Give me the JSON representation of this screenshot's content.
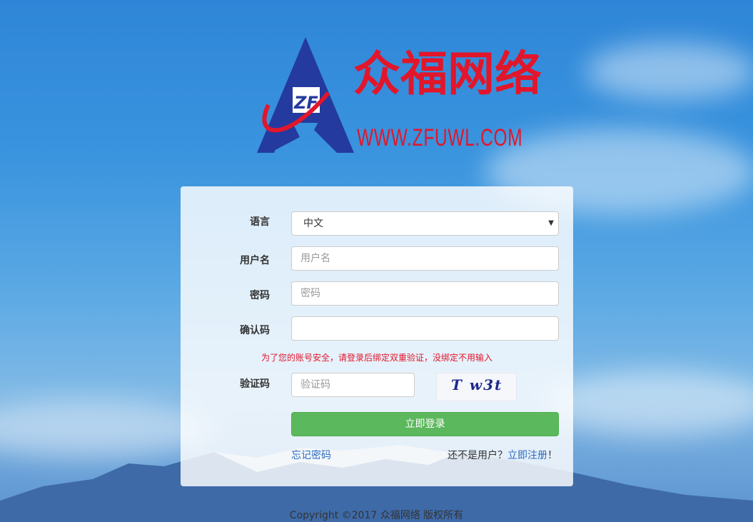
{
  "brand": {
    "name_cn": "众福网络",
    "url_text": "WWW.ZFUWL.COM",
    "logo_monogram": "ZF",
    "primary_color": "#e2162b",
    "logo_blue": "#243a9e"
  },
  "form": {
    "language": {
      "label": "语言",
      "selected": "中文"
    },
    "username": {
      "label": "用户名",
      "placeholder": "用户名",
      "value": ""
    },
    "password": {
      "label": "密码",
      "placeholder": "密码",
      "value": ""
    },
    "confirm_code": {
      "label": "确认码",
      "placeholder": "",
      "value": ""
    },
    "notice": "为了您的账号安全，请登录后绑定双重验证，没绑定不用输入",
    "captcha": {
      "label": "验证码",
      "placeholder": "验证码",
      "value": "",
      "image_text": "T w3t"
    },
    "login_button": "立即登录",
    "forgot_link": "忘记密码",
    "register_prompt": "还不是用户？",
    "register_link": "立即注册",
    "register_suffix": "！",
    "button_color": "#5cb85c"
  },
  "footer": {
    "copyright": "Copyright ©2017 众福网络 版权所有"
  }
}
